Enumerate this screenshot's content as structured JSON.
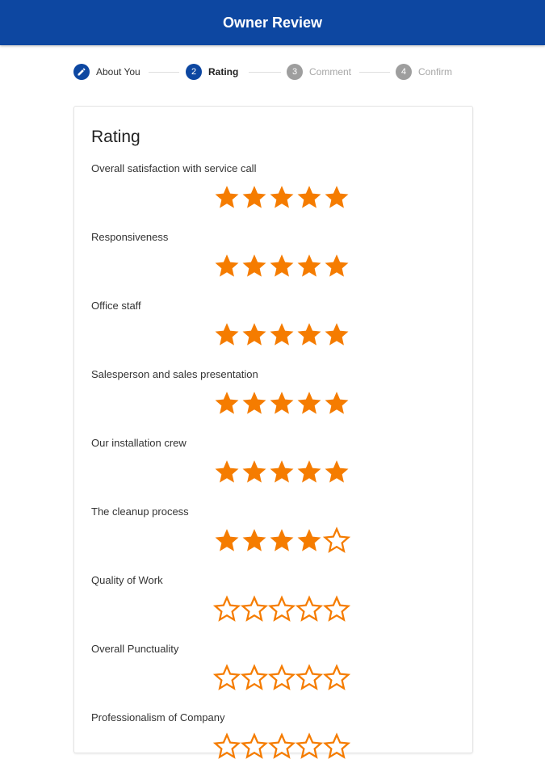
{
  "app_bar": {
    "title": "Owner Review"
  },
  "stepper": {
    "steps": [
      {
        "number": "",
        "label": "About You",
        "state": "done"
      },
      {
        "number": "2",
        "label": "Rating",
        "state": "active"
      },
      {
        "number": "3",
        "label": "Comment",
        "state": "inactive"
      },
      {
        "number": "4",
        "label": "Confirm",
        "state": "inactive"
      }
    ]
  },
  "card": {
    "title": "Rating",
    "star_color": "#f57c00",
    "max_stars": 5,
    "questions": [
      {
        "label": "Overall satisfaction with service call",
        "rating": 5
      },
      {
        "label": "Responsiveness",
        "rating": 5
      },
      {
        "label": "Office staff",
        "rating": 5
      },
      {
        "label": "Salesperson and sales presentation",
        "rating": 5
      },
      {
        "label": "Our installation crew",
        "rating": 5
      },
      {
        "label": "The cleanup process",
        "rating": 4
      },
      {
        "label": "Quality of Work",
        "rating": 0
      },
      {
        "label": "Overall Punctuality",
        "rating": 0
      },
      {
        "label": "Professionalism of Company",
        "rating": 0
      }
    ]
  }
}
